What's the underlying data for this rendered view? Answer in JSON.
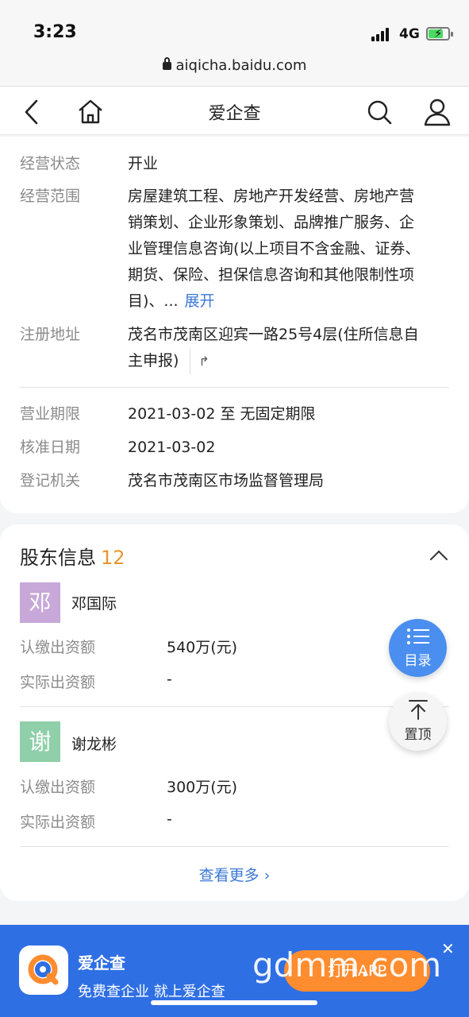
{
  "status_bar": {
    "time": "3:23",
    "network": "4G"
  },
  "browser": {
    "url": "aiqicha.baidu.com"
  },
  "nav": {
    "title": "爱企查"
  },
  "business_info": {
    "status_label": "经营状态",
    "status_value": "开业",
    "scope_label": "经营范围",
    "scope_lines": [
      "房屋建筑工程、房地产开发经营、房地产营",
      "销策划、企业形象策划、品牌推广服务、企",
      "业管理信息咨询(以上项目不含金融、证券、",
      "期货、保险、担保信息咨询和其他限制性项",
      "目)、..."
    ],
    "expand_label": "展开",
    "address_label": "注册地址",
    "address_lines": [
      "茂名市茂南区迎宾一路25号4层(住所信息自",
      "主申报)"
    ],
    "term_label": "营业期限",
    "term_value": "2021-03-02 至 无固定期限",
    "approval_label": "核准日期",
    "approval_value": "2021-03-02",
    "authority_label": "登记机关",
    "authority_value": "茂名市茂南区市场监督管理局"
  },
  "shareholders": {
    "title": "股东信息",
    "count": "12",
    "items": [
      {
        "avatar": "邓",
        "avatar_color": "#c7a8d8",
        "name": "邓国际",
        "subscribed_label": "认缴出资额",
        "subscribed_value": "540万(元)",
        "paid_label": "实际出资额",
        "paid_value": "-"
      },
      {
        "avatar": "谢",
        "avatar_color": "#8fcfa9",
        "name": "谢龙彬",
        "subscribed_label": "认缴出资额",
        "subscribed_value": "300万(元)",
        "paid_label": "实际出资额",
        "paid_value": "-"
      }
    ],
    "view_more": "查看更多"
  },
  "floating": {
    "toc_label": "目录",
    "top_label": "置顶"
  },
  "banner": {
    "app_name": "爱企查",
    "slogan": "免费查企业 就上爱企查",
    "open_button": "打开APP"
  },
  "watermark": "gdmm.com",
  "colors": {
    "accent": "#3a78d6",
    "banner": "#2f6fe4",
    "count": "#e8962e"
  }
}
